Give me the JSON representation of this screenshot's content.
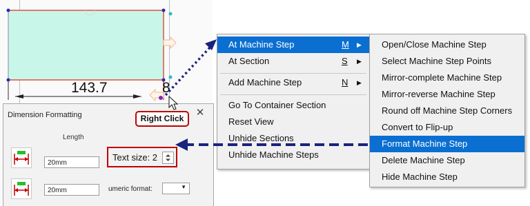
{
  "canvas": {
    "dimension_value": "143.7",
    "dimension_partial": "8"
  },
  "callout": {
    "label": "Right Click"
  },
  "dialog": {
    "title": "Dimension Formatting",
    "length_header": "Length",
    "row1_value": "20mm",
    "text_size_label": "Text size: 2",
    "row2_value": "20mm",
    "numeric_format_label": "umeric format:"
  },
  "context_menu": {
    "items": [
      {
        "label": "At Machine Step",
        "accel": "M",
        "submenu": true
      },
      {
        "label": "At Section",
        "accel": "S",
        "submenu": true
      },
      {
        "label": "Add Machine Step",
        "accel": "N",
        "submenu": true
      },
      {
        "label": "Go To Container Section"
      },
      {
        "label": "Reset View"
      },
      {
        "label": "Unhide Sections"
      },
      {
        "label": "Unhide Machine Steps"
      }
    ]
  },
  "submenu": {
    "items": [
      {
        "label": "Open/Close Machine Step"
      },
      {
        "label": "Select Machine Step Points"
      },
      {
        "label": "Mirror-complete Machine Step"
      },
      {
        "label": "Mirror-reverse Machine Step"
      },
      {
        "label": "Round off Machine Step Corners"
      },
      {
        "label": "Convert to Flip-up"
      },
      {
        "label": "Format Machine Step"
      },
      {
        "label": "Delete Machine Step"
      },
      {
        "label": "Hide Machine Step"
      }
    ]
  },
  "colors": {
    "selection": "#0a6fd1",
    "highlight_red": "#c00000",
    "arrow_navy": "#1a237e",
    "shape_fill": "#c8f7ea",
    "shape_outline": "#e0503a"
  }
}
